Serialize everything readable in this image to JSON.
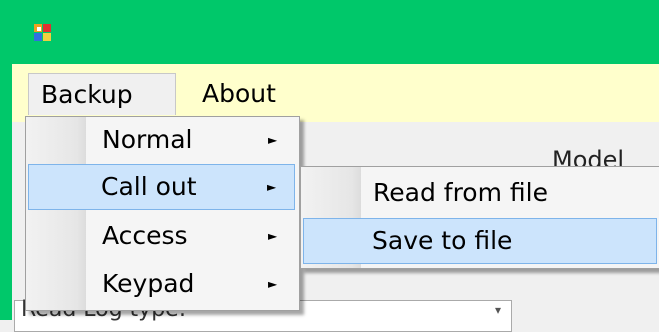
{
  "menubar": {
    "items": [
      {
        "label": "Backup"
      },
      {
        "label": "About"
      }
    ]
  },
  "backup_menu": {
    "items": [
      {
        "label": "Normal",
        "has_submenu": true
      },
      {
        "label": "Call out",
        "has_submenu": true,
        "highlighted": true
      },
      {
        "label": "Access",
        "has_submenu": true
      },
      {
        "label": "Keypad",
        "has_submenu": true
      }
    ]
  },
  "callout_submenu": {
    "items": [
      {
        "label": "Read from file"
      },
      {
        "label": "Save to file",
        "highlighted": true
      }
    ]
  },
  "form": {
    "model_label": "Model",
    "read_log_label": "Read Log type:"
  },
  "icons": {
    "app": "app-icon",
    "submenu_arrow": "submenu-arrow-icon"
  },
  "colors": {
    "titlebar": "#00c86a",
    "menubar": "#ffffcc",
    "highlight": "#cce4fc",
    "highlight_border": "#7eb4ea"
  }
}
